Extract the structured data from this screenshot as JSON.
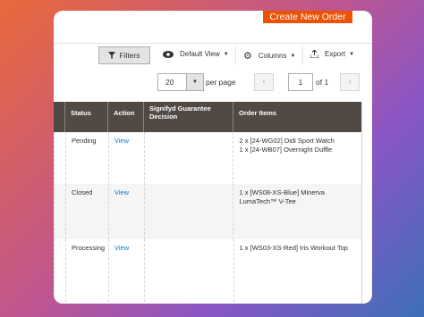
{
  "header": {
    "create_order_label": "Create New Order"
  },
  "toolbar": {
    "filters_label": "Filters",
    "view_label": "Default View",
    "columns_label": "Columns",
    "export_label": "Export"
  },
  "pagination": {
    "per_page_value": "20",
    "per_page_label": "per page",
    "current_page": "1",
    "of_label": "of 1"
  },
  "grid": {
    "headers": [
      "Status",
      "Action",
      "Signifyd Guarantee Decision",
      "Order Items"
    ],
    "rows": [
      {
        "status": "Pending",
        "action": "View",
        "decision": "",
        "items": [
          "2 x [24-WG02] Didi Sport Watch",
          "1 x [24-WB07] Overnight Duffle"
        ]
      },
      {
        "status": "Closed",
        "action": "View",
        "decision": "",
        "items": [
          "1 x [WS08-XS-Blue] Minerva",
          "LumaTech™ V-Tee"
        ]
      },
      {
        "status": "Processing",
        "action": "View",
        "decision": "",
        "items": [
          "1 x [WS03-XS-Red] Iris Workout Top",
          ""
        ]
      }
    ]
  },
  "colors": {
    "accent": "#eb5202",
    "header_bg": "#514943",
    "link": "#007bdb"
  }
}
